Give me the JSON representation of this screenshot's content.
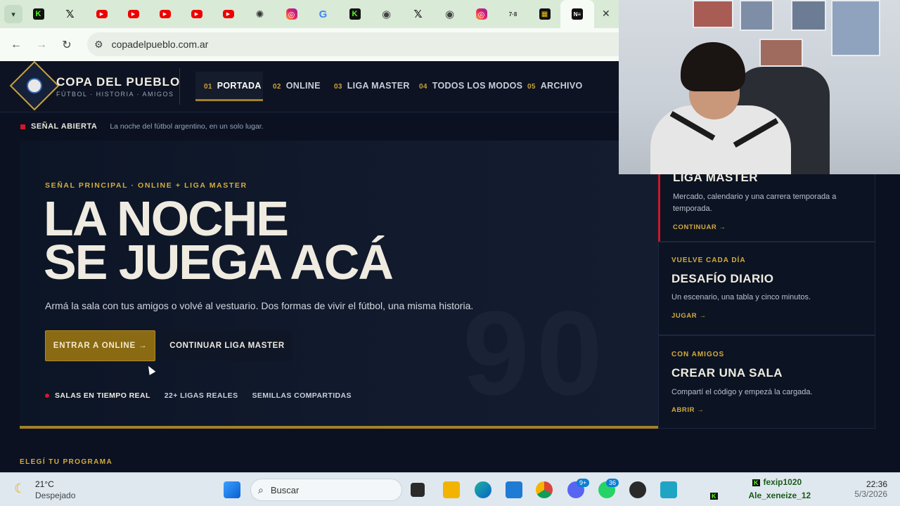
{
  "browser": {
    "url": "copadelpueblo.com.ar",
    "tab_icons": [
      "kick-icon",
      "x-icon",
      "youtube-icon",
      "youtube-icon",
      "youtube-icon",
      "youtube-icon",
      "youtube-icon",
      "chatgpt-icon",
      "instagram-icon",
      "google-icon",
      "kick-icon",
      "chrome-icon",
      "x-icon",
      "chrome-icon",
      "instagram-icon",
      "78-icon",
      "grid-icon",
      "news-icon"
    ],
    "tab_78_text": "7·8",
    "tab_n_text": "N≡",
    "close_glyph": "✕"
  },
  "site": {
    "brand": "COPA DEL PUEBLO",
    "tagline": "FÚTBOL · HISTORIA · AMIGOS",
    "nav": [
      {
        "num": "01",
        "label": "PORTADA"
      },
      {
        "num": "02",
        "label": "ONLINE"
      },
      {
        "num": "03",
        "label": "LIGA MASTER"
      },
      {
        "num": "04",
        "label": "TODOS LOS MODOS"
      },
      {
        "num": "05",
        "label": "ARCHIVO"
      }
    ],
    "ticker_label": "SEÑAL ABIERTA",
    "ticker_text": "La noche del fútbol argentino, en un solo lugar.",
    "hero": {
      "kicker": "SEÑAL PRINCIPAL · ONLINE + LIGA MASTER",
      "title_line1": "LA NOCHE",
      "title_line2": "SE JUEGA ACÁ",
      "lede": "Armá la sala con tus amigos o volvé al vestuario. Dos formas de vivir el fútbol, una misma historia.",
      "primary_cta": "ENTRAR A ONLINE →",
      "secondary_cta": "CONTINUAR LIGA MASTER",
      "chips": [
        "SALAS EN TIEMPO REAL",
        "22+ LIGAS REALES",
        "SEMILLAS COMPARTIDAS"
      ],
      "watermark": "90"
    },
    "cards": [
      {
        "kicker": "",
        "title": "LIGA MASTER",
        "desc": "Mercado, calendario y una carrera temporada a temporada.",
        "link": "CONTINUAR →"
      },
      {
        "kicker": "VUELVE CADA DÍA",
        "title": "DESAFÍO DIARIO",
        "desc": "Un escenario, una tabla y cinco minutos.",
        "link": "JUGAR →"
      },
      {
        "kicker": "CON AMIGOS",
        "title": "CREAR UNA SALA",
        "desc": "Compartí el código y empezá la cargada.",
        "link": "ABRIR →"
      }
    ],
    "section_label": "ELEGÍ TU PROGRAMA"
  },
  "taskbar": {
    "weather_temp": "21°C",
    "weather_desc": "Despejado",
    "search_placeholder": "Buscar",
    "discord_badge": "9+",
    "whatsapp_badge": "36",
    "tray_user1": "fexip1020",
    "tray_user2": "Ale_xeneize_12",
    "time": "22:36",
    "date": "5/3/2026"
  }
}
